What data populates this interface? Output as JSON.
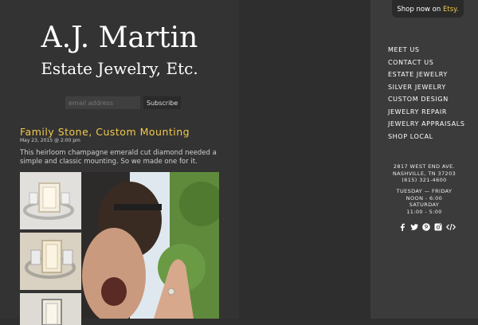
{
  "site": {
    "title_line1": "A.J. Martin",
    "title_line2": "Estate Jewelry, Etc."
  },
  "subscribe": {
    "placeholder": "email address",
    "button_label": "Subscribe"
  },
  "post": {
    "title": "Family Stone, Custom Mounting",
    "date": "May 23, 2015 @ 2:00 pm",
    "body": "This heirloom champagne emerald cut diamond needed a simple and classic mounting. So we made one for it."
  },
  "etsy": {
    "prefix": "Shop now on ",
    "brand": "Etsy."
  },
  "nav": {
    "items": [
      "MEET US",
      "CONTACT US",
      "ESTATE JEWELRY",
      "SILVER JEWELRY",
      "CUSTOM DESIGN",
      "JEWELRY REPAIR",
      "JEWELRY APPRAISALS",
      "SHOP LOCAL"
    ]
  },
  "contact": {
    "street": "2817 WEST END AVE.",
    "city": "NASHVILLE, TN 37203",
    "phone": "(615) 321-4600"
  },
  "hours": {
    "line1": "TUESDAY — FRIDAY",
    "line2": "NOON - 6:00",
    "line3": "SATURDAY",
    "line4": "11:00 - 5:00"
  },
  "social": {
    "icons": [
      "facebook-icon",
      "twitter-icon",
      "pinterest-icon",
      "instagram-icon",
      "code-icon"
    ]
  },
  "colors": {
    "accent": "#f2c94c",
    "page_bg": "#2f2f2f",
    "sidebar_bg": "#3b3b3b"
  }
}
